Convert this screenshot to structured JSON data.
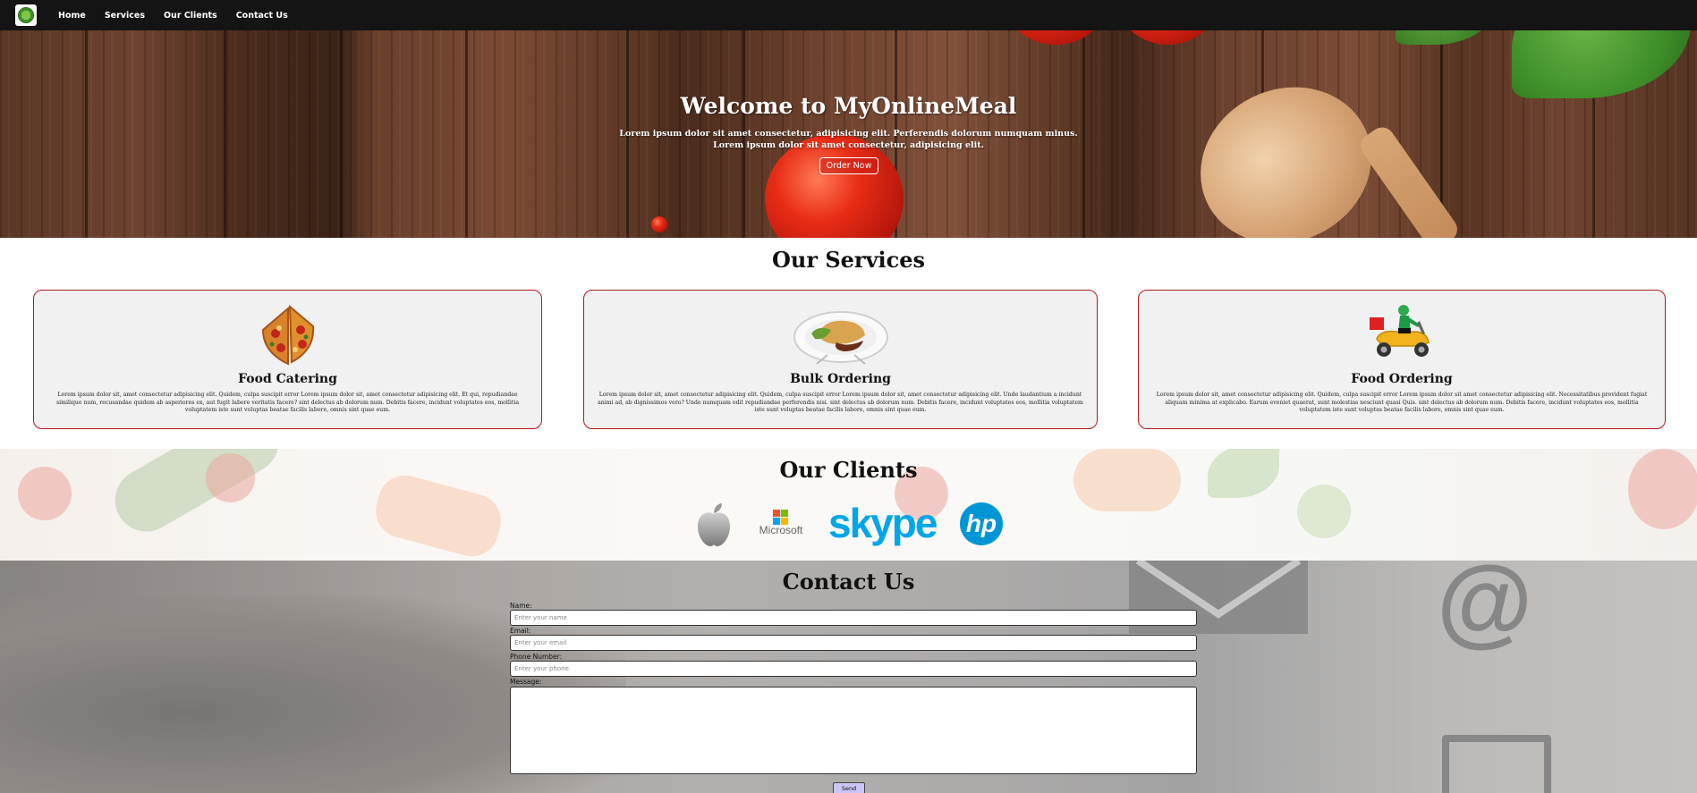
{
  "nav": {
    "logo_icon": "android-logo-icon",
    "links": [
      "Home",
      "Services",
      "Our Clients",
      "Contact Us"
    ]
  },
  "hero": {
    "title": "Welcome to MyOnlineMeal",
    "subtitle_line1": "Lorem ipsum dolor sit amet consectetur, adipisicing elit. Perferendis dolorum numquam minus.",
    "subtitle_line2": "Lorem ipsum dolor sit amet consectetur, adipisicing elit.",
    "button": "Order Now"
  },
  "services": {
    "title": "Our Services",
    "cards": [
      {
        "icon": "pizza-slices-icon",
        "title": "Food Catering",
        "text": "Lorem ipsum dolor sit, amet consectetur adipisicing elit. Quidem, culpa suscipit error Lorem ipsum dolor sit, amet consectetur adipisicing elit. Et qui, repudiandae similique num, recusandae quidem ab asperiores ex, aut fugit labore veritatis facere? sint delectus ab dolorum num. Debitis facere, incidunt voluptates eos, mollitia voluptatem iste sunt voluptas beatae facilis labore, omnis sint quae eum."
      },
      {
        "icon": "meal-plate-icon",
        "title": "Bulk Ordering",
        "text": "Lorem ipsum dolor sit, amet consectetur adipisicing elit. Quidem, culpa suscipit error Lorem ipsum dolor sit, amet consectetur adipisicing elit. Unde laudantium a incidunt animi ad, ab dignissimos vero? Unde numquam odit repudiandae perferendis nisi. sint delectus ab dolorum num. Debitis facere, incidunt voluptates eos, mollitia voluptatem iste sunt voluptas beatae facilis labore, omnis sint quae eum."
      },
      {
        "icon": "delivery-scooter-icon",
        "title": "Food Ordering",
        "text": "Lorem ipsum dolor sit, amet consectetur adipisicing elit. Quidem, culpa suscipit error Lorem ipsum dolor sit amet consectetur adipisicing elit. Necessitatibus provident fugiat aliquam minima at explicabo. Earum eveniet quaerat, sunt molestias nesciunt quasi Quis. sint delectus ab dolorum num. Debitis facere, incidunt voluptates eos, mollitia voluptatem iste sunt voluptas beatae facilis labore, omnis sint quae eum."
      }
    ]
  },
  "clients": {
    "title": "Our Clients",
    "logos": [
      "apple-logo-icon",
      "microsoft-logo-icon",
      "skype-logo-icon",
      "hp-logo-icon"
    ],
    "microsoft_label": "Microsoft",
    "skype_label": "skype",
    "hp_label": "hp"
  },
  "contact": {
    "title": "Contact Us",
    "name_label": "Name:",
    "name_placeholder": "Enter your name",
    "email_label": "Email:",
    "email_placeholder": "Enter your email",
    "phone_label": "Phone Number:",
    "phone_placeholder": "Enter your phone",
    "message_label": "Message:",
    "send": "Send"
  }
}
